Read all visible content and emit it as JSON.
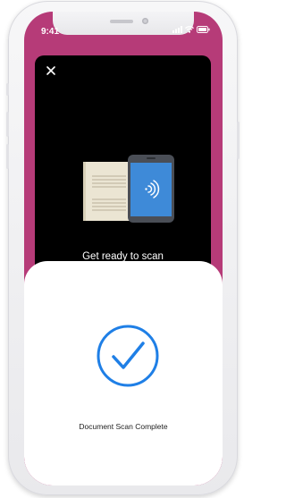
{
  "status_bar": {
    "time": "9:41",
    "icons": [
      "signal-icon",
      "wifi-icon",
      "battery-icon"
    ]
  },
  "scan_screen": {
    "close_icon": "close-icon",
    "illustration": "document-phone-nfc-illustration",
    "ready_text": "Get ready to scan"
  },
  "result_sheet": {
    "status_icon": "check-circle-icon",
    "message": "Document Scan Complete"
  },
  "colors": {
    "screen_background": "#b63b78",
    "scan_card": "#000000",
    "sheet": "#ffffff",
    "accent": "#1f7fe6",
    "phone_screen": "#3e8ad8"
  }
}
